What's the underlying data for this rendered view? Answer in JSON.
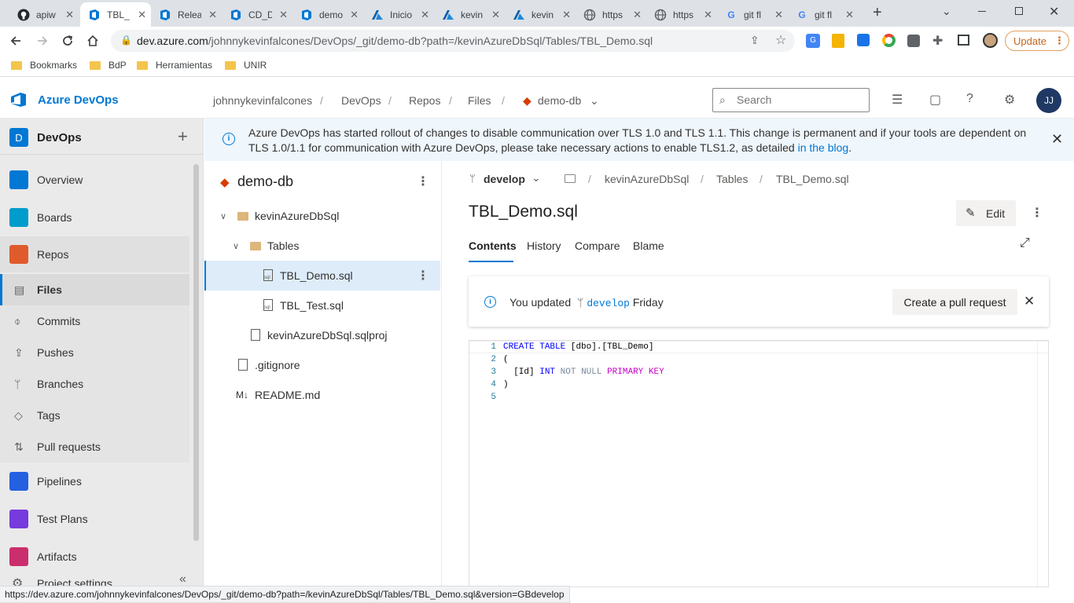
{
  "browser": {
    "tabs": [
      {
        "title": "apiw",
        "icon": "github-icon"
      },
      {
        "title": "TBL_",
        "icon": "azure-repos-icon",
        "active": true
      },
      {
        "title": "Relea",
        "icon": "azure-pipelines-icon"
      },
      {
        "title": "CD_D",
        "icon": "azure-pipelines-icon"
      },
      {
        "title": "demo",
        "icon": "azure-repos-icon"
      },
      {
        "title": "Inicio",
        "icon": "azure-icon"
      },
      {
        "title": "kevin",
        "icon": "azure-icon"
      },
      {
        "title": "kevin",
        "icon": "azure-icon"
      },
      {
        "title": "https",
        "icon": "globe-icon"
      },
      {
        "title": "https",
        "icon": "globe-icon"
      },
      {
        "title": "git fl",
        "icon": "google-icon"
      },
      {
        "title": "git fl",
        "icon": "google-icon"
      }
    ],
    "url_host": "dev.azure.com",
    "url_path": "/johnnykevinfalcones/DevOps/_git/demo-db?path=/kevinAzureDbSql/Tables/TBL_Demo.sql",
    "update_label": "Update",
    "bookmarks": [
      "Bookmarks",
      "BdP",
      "Herramientas",
      "UNIR"
    ],
    "status_url": "https://dev.azure.com/johnnykevinfalcones/DevOps/_git/demo-db?path=/kevinAzureDbSql/Tables/TBL_Demo.sql&version=GBdevelop"
  },
  "header": {
    "brand": "Azure DevOps",
    "breadcrumbs": [
      "johnnykevinfalcones",
      "DevOps",
      "Repos",
      "Files",
      "demo-db"
    ],
    "search_placeholder": "Search",
    "avatar_initials": "JJ"
  },
  "sidebar": {
    "project_initial": "D",
    "project_name": "DevOps",
    "items": [
      {
        "label": "Overview",
        "color": "#0078d4"
      },
      {
        "label": "Boards",
        "color": "#009ccc"
      },
      {
        "label": "Repos",
        "color": "#e05b2b"
      },
      {
        "label": "Pipelines",
        "color": "#2560e0"
      },
      {
        "label": "Test Plans",
        "color": "#773adc"
      },
      {
        "label": "Artifacts",
        "color": "#cb2e6d"
      }
    ],
    "repo_subitems": [
      "Files",
      "Commits",
      "Pushes",
      "Branches",
      "Tags",
      "Pull requests"
    ],
    "settings_label": "Project settings"
  },
  "banner": {
    "text": "Azure DevOps has started rollout of changes to disable communication over TLS 1.0 and TLS 1.1. This change is permanent and if your tools are dependent on TLS 1.0/1.1 for communication with Azure DevOps, please take necessary actions to enable TLS1.2, as detailed ",
    "link": "in the blog",
    "tail": "."
  },
  "tree": {
    "repo_name": "demo-db",
    "nodes": [
      "kevinAzureDbSql",
      "Tables",
      "TBL_Demo.sql",
      "TBL_Test.sql",
      "kevinAzureDbSql.sqlproj",
      ".gitignore",
      "README.md"
    ]
  },
  "file": {
    "branch": "develop",
    "path": [
      "kevinAzureDbSql",
      "Tables",
      "TBL_Demo.sql"
    ],
    "title": "TBL_Demo.sql",
    "edit_label": "Edit",
    "tabs": [
      "Contents",
      "History",
      "Compare",
      "Blame"
    ],
    "notice_prefix": "You updated",
    "notice_branch": "develop",
    "notice_suffix": "Friday",
    "pr_button": "Create a pull request",
    "code_lines": [
      "CREATE TABLE [dbo].[TBL_Demo]",
      "(",
      "  [Id] INT NOT NULL PRIMARY KEY",
      ")",
      ""
    ],
    "line_numbers": [
      "1",
      "2",
      "3",
      "4",
      "5"
    ]
  },
  "colors": {
    "accent": "#0078d4",
    "brand_dark": "#1f3864"
  }
}
